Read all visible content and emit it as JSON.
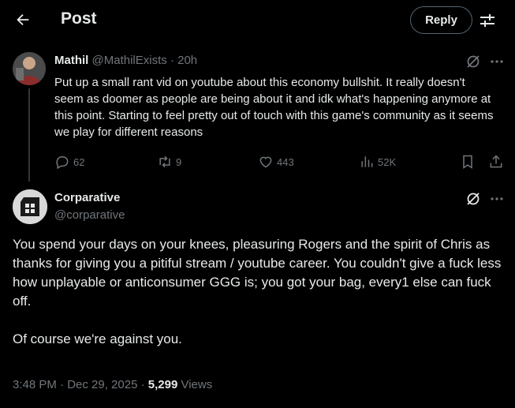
{
  "header": {
    "title": "Post",
    "reply_label": "Reply"
  },
  "parent_tweet": {
    "display_name": "Mathil",
    "handle": "@MathilExists",
    "separator": "·",
    "time": "20h",
    "text": "Put up a small rant vid on youtube about this economy bullshit. It really doesn't seem as doomer as people are being about it and idk what's happening anymore at this point. Starting to feel pretty out of touch with this game's community as it seems we play for different reasons",
    "stats": {
      "replies": "62",
      "reposts": "9",
      "likes": "443",
      "views": "52K"
    }
  },
  "main_tweet": {
    "display_name": "Corparative",
    "handle": "@corparative",
    "paragraph1": "You spend your days on your knees, pleasuring Rogers and the spirit of Chris as thanks for giving you a pitiful stream / youtube career. You couldn't give a fuck less how unplayable or anticonsumer GGG is; you got your bag, every1 else can fuck off.",
    "paragraph2": "Of course we're against you.",
    "timestamp": "3:48 PM · Dec 29, 2025 · ",
    "views_count": "5,299",
    "views_label": " Views"
  },
  "icons": {
    "back": "arrow-left-icon",
    "filter": "sliders-icon",
    "grok": "grok-icon",
    "more": "more-horizontal-icon",
    "reply": "reply-bubble-icon",
    "repost": "repost-icon",
    "like": "heart-icon",
    "views": "bar-chart-icon",
    "bookmark": "bookmark-icon",
    "share": "share-icon"
  },
  "colors": {
    "background": "#000000",
    "text": "#e7e9ea",
    "muted": "#71767b",
    "border": "#536471"
  }
}
